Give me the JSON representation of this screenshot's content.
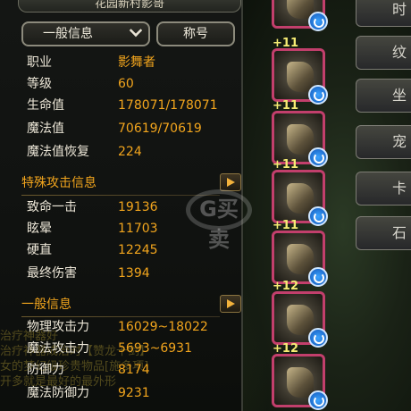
{
  "header": {
    "partial_title": "花园新村影哥"
  },
  "tabs": {
    "general": "一般信息",
    "title": "称号"
  },
  "basic_stats": [
    {
      "label": "职业",
      "value": "影舞者"
    },
    {
      "label": "等级",
      "value": "60"
    },
    {
      "label": "生命值",
      "value": "178071/178071"
    },
    {
      "label": "魔法值",
      "value": "70619/70619"
    },
    {
      "label": "魔法值恢复",
      "value": "224"
    }
  ],
  "special_section": {
    "title": "特殊攻击信息"
  },
  "special_stats": [
    {
      "label": "致命一击",
      "value": "19136"
    },
    {
      "label": "眩晕",
      "value": "11703"
    },
    {
      "label": "硬直",
      "value": "12245"
    },
    {
      "label": "最终伤害",
      "value": "1394"
    }
  ],
  "general_section": {
    "title": "一般信息"
  },
  "general_stats": [
    {
      "label": "物理攻击力",
      "value": "16029~18022"
    },
    {
      "label": "魔法攻击力",
      "value": "5693~6931"
    },
    {
      "label": "防御力",
      "value": "8174"
    },
    {
      "label": "魔法防御力",
      "value": "9231"
    }
  ],
  "equipment": [
    {
      "enhance": ""
    },
    {
      "enhance": "+11"
    },
    {
      "enhance": "+11"
    },
    {
      "enhance": "+11"
    },
    {
      "enhance": "+11"
    },
    {
      "enhance": "+12"
    },
    {
      "enhance": "+12"
    }
  ],
  "side_menu": [
    "时",
    "纹",
    "坐",
    "宠",
    "卡",
    "石"
  ],
  "chat_lines": [
    "治疗神器好",
    "治疗神器成治时【赞龙十剑】",
    "女的梦幻级珍贵物品[施多项]",
    "开多就是最好的最外形"
  ],
  "watermark": "G买卖"
}
